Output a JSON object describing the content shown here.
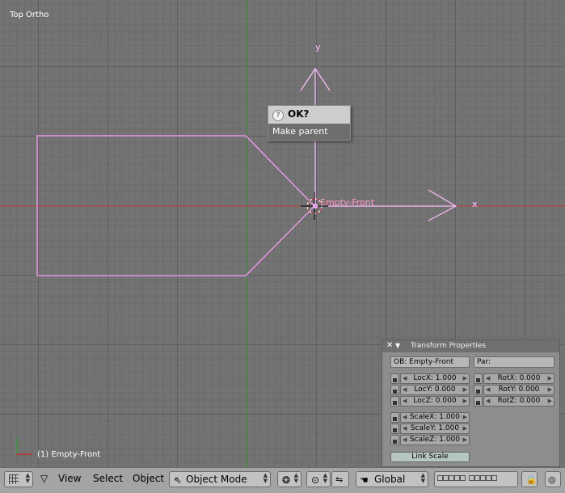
{
  "viewport": {
    "view_name": "Top Ortho",
    "object_name": "Empty-Front",
    "status": "(1) Empty-Front",
    "axis_y": "y",
    "axis_x": "x"
  },
  "popup": {
    "title": "OK?",
    "help_icon": "?",
    "item": "Make parent"
  },
  "transform_panel": {
    "close_icon": "✕",
    "collapse_icon": "▼",
    "title": "Transform Properties",
    "ob_field": "OB: Empty-Front",
    "par_field": "Par:",
    "loc": [
      "LocX: 1.000",
      "LocY: 0.000",
      "LocZ: 0.000"
    ],
    "rot": [
      "RotX: 0.000",
      "RotY: 0.000",
      "RotZ: 0.000"
    ],
    "scale": [
      "ScaleX: 1.000",
      "ScaleY: 1.000",
      "ScaleZ: 1.000"
    ],
    "link_scale": "Link Scale"
  },
  "header": {
    "menus": [
      "View",
      "Select",
      "Object"
    ],
    "mode": "Object Mode",
    "orientation": "Global"
  },
  "colors": {
    "grid_bg": "#737373",
    "selection": "#ffa0ff",
    "x_axis": "#c84040",
    "y_axis": "#3a9a3a"
  }
}
